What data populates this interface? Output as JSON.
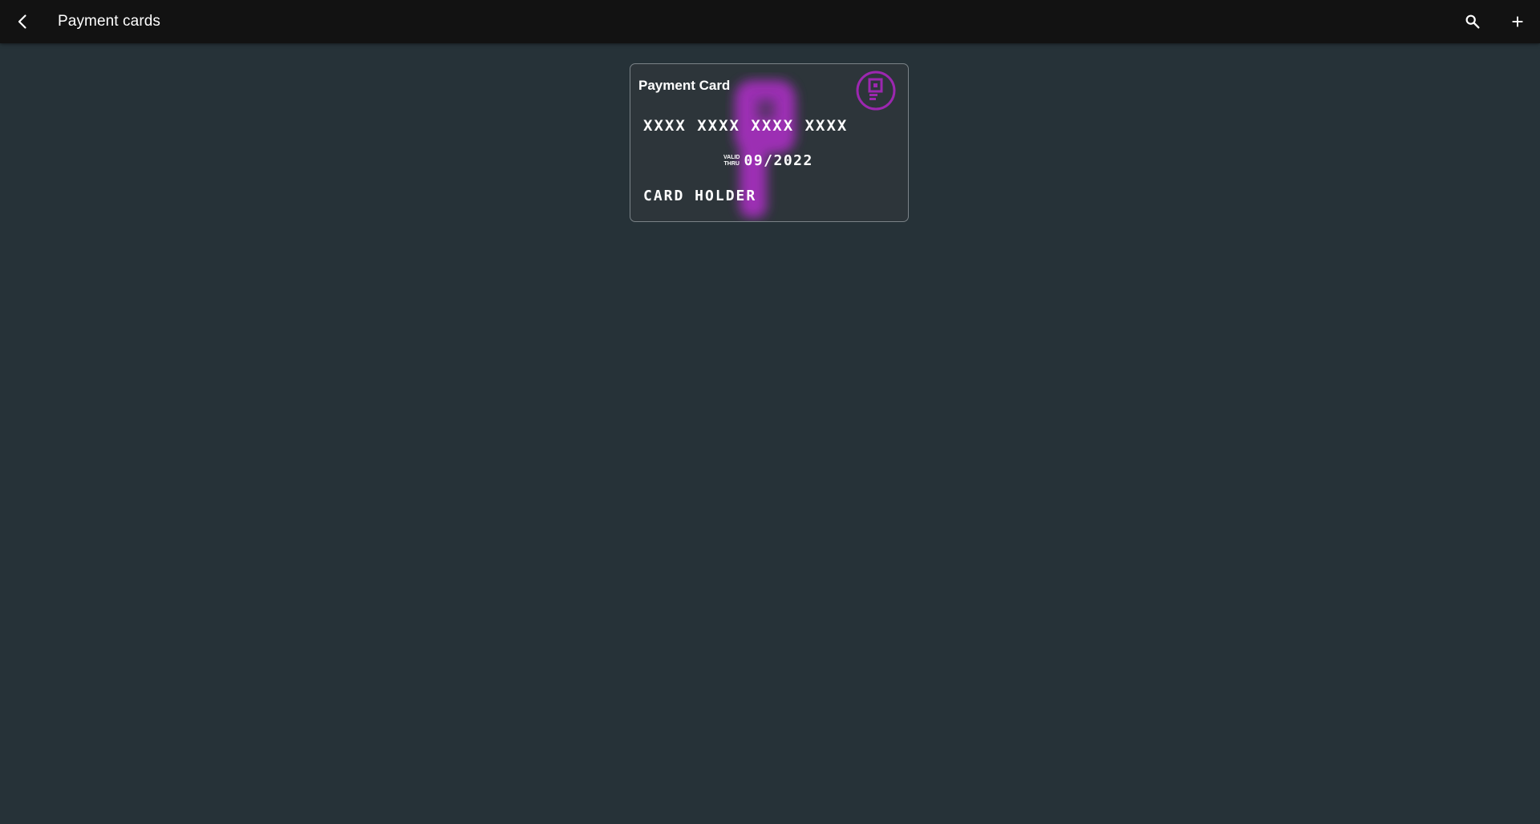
{
  "appbar": {
    "title": "Payment cards",
    "back_icon": "arrow-back-icon",
    "search_icon": "search-icon",
    "add_icon": "add-icon"
  },
  "card": {
    "title": "Payment Card",
    "number": "XXXX XXXX XXXX XXXX",
    "valid_label_top": "VALID",
    "valid_label_bottom": "THRU",
    "expiry": "09/2022",
    "holder": "CARD HOLDER",
    "logo_icon": "card-brand-logo-icon",
    "accent_color": "#9c27b0"
  },
  "colors": {
    "background": "#263238",
    "appbar": "#121212",
    "card_border": "#7b8388"
  }
}
